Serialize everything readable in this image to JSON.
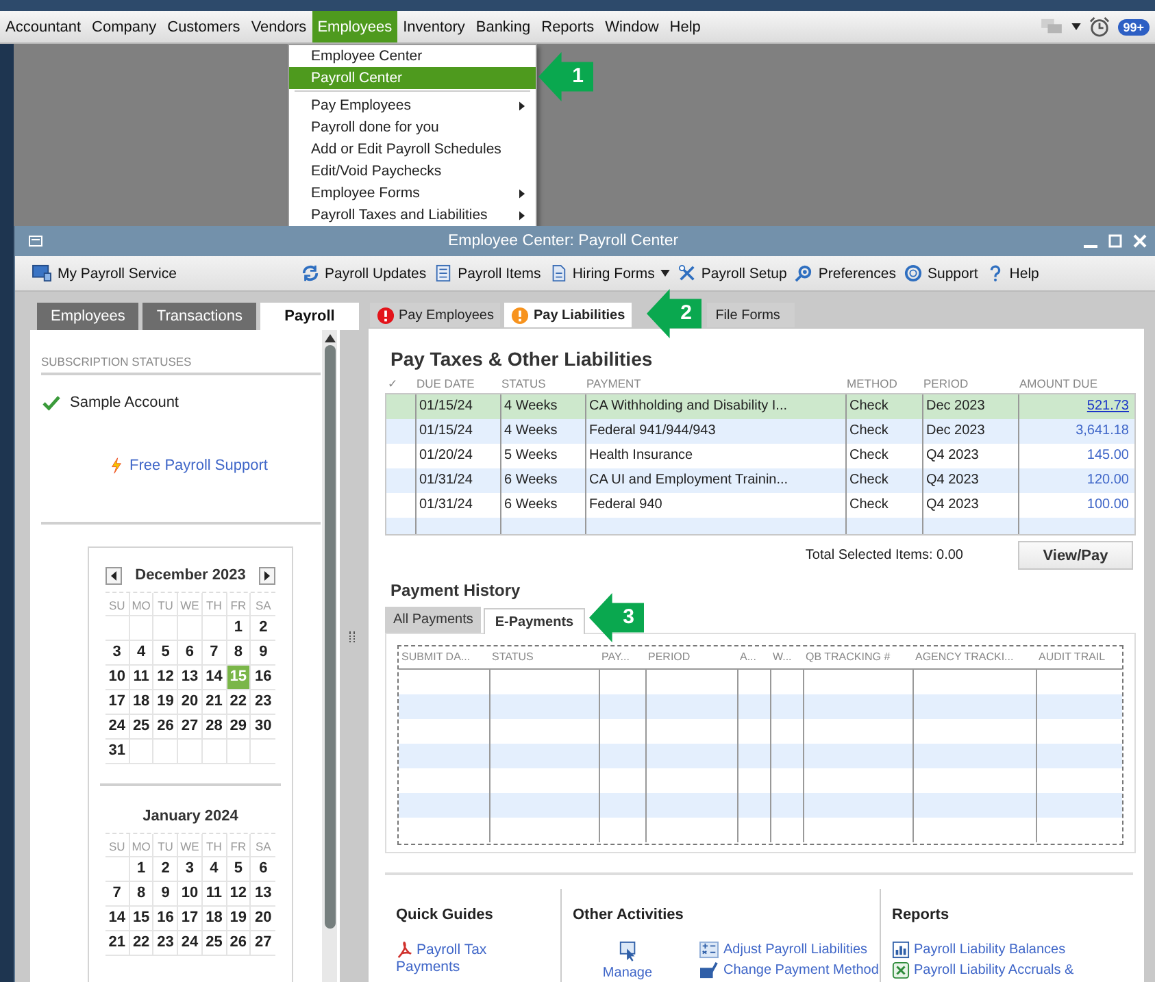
{
  "menubar": {
    "items": [
      {
        "label": "Accountant",
        "selected": false
      },
      {
        "label": "Company",
        "selected": false
      },
      {
        "label": "Customers",
        "selected": false
      },
      {
        "label": "Vendors",
        "selected": false
      },
      {
        "label": "Employees",
        "selected": true
      },
      {
        "label": "Inventory",
        "selected": false
      },
      {
        "label": "Banking",
        "selected": false
      },
      {
        "label": "Reports",
        "selected": false
      },
      {
        "label": "Window",
        "selected": false
      },
      {
        "label": "Help",
        "selected": false
      }
    ],
    "badge": "99+"
  },
  "employees_menu": {
    "items": [
      {
        "kind": "item",
        "label": "Employee Center",
        "selected": false,
        "submenu": false
      },
      {
        "kind": "item",
        "label": "Payroll Center",
        "selected": true,
        "submenu": false
      },
      {
        "kind": "separator"
      },
      {
        "kind": "item",
        "label": "Pay Employees",
        "selected": false,
        "submenu": true
      },
      {
        "kind": "item",
        "label": "Payroll done for you",
        "selected": false,
        "submenu": false
      },
      {
        "kind": "item",
        "label": "Add or Edit Payroll Schedules",
        "selected": false,
        "submenu": false
      },
      {
        "kind": "item",
        "label": "Edit/Void Paychecks",
        "selected": false,
        "submenu": false
      },
      {
        "kind": "item",
        "label": "Employee Forms",
        "selected": false,
        "submenu": true
      },
      {
        "kind": "item",
        "label": "Payroll Taxes and Liabilities",
        "selected": false,
        "submenu": true
      }
    ]
  },
  "callouts": [
    {
      "number": "1"
    },
    {
      "number": "2"
    },
    {
      "number": "3"
    }
  ],
  "window": {
    "title": "Employee Center: Payroll Center",
    "toolbar": {
      "service": "My Payroll Service",
      "items": [
        {
          "label": "Payroll Updates",
          "dropdown": false
        },
        {
          "label": "Payroll Items",
          "dropdown": false
        },
        {
          "label": "Hiring Forms",
          "dropdown": true
        },
        {
          "label": "Payroll Setup",
          "dropdown": false
        },
        {
          "label": "Preferences",
          "dropdown": false
        },
        {
          "label": "Support",
          "dropdown": false
        },
        {
          "label": "Help",
          "dropdown": false
        }
      ]
    }
  },
  "sidebar": {
    "tabs": [
      {
        "label": "Employees",
        "selected": false
      },
      {
        "label": "Transactions",
        "selected": false
      },
      {
        "label": "Payroll",
        "selected": true
      }
    ],
    "subscription_heading": "SUBSCRIPTION STATUSES",
    "subscriptions": [
      "Sample Account"
    ],
    "support_link": "Free Payroll Support",
    "calendars": [
      {
        "month": "December 2023",
        "nav_arrows": true,
        "weekdays": [
          "SU",
          "MO",
          "TU",
          "WE",
          "TH",
          "FR",
          "SA"
        ],
        "weeks": [
          {
            "kind": "first",
            "days": [
              {
                "day": "1",
                "selected": false
              },
              {
                "day": "2",
                "selected": false
              }
            ]
          },
          {
            "days": [
              {
                "day": "3",
                "selected": false
              },
              {
                "day": "4",
                "selected": false
              },
              {
                "day": "5",
                "selected": false
              },
              {
                "day": "6",
                "selected": false
              },
              {
                "day": "7",
                "selected": false
              },
              {
                "day": "8",
                "selected": false
              },
              {
                "day": "9",
                "selected": false
              }
            ]
          },
          {
            "days": [
              {
                "day": "10",
                "selected": false
              },
              {
                "day": "11",
                "selected": false
              },
              {
                "day": "12",
                "selected": false
              },
              {
                "day": "13",
                "selected": false
              },
              {
                "day": "14",
                "selected": false
              },
              {
                "day": "15",
                "selected": true
              },
              {
                "day": "16",
                "selected": false
              }
            ]
          },
          {
            "days": [
              {
                "day": "17",
                "selected": false
              },
              {
                "day": "18",
                "selected": false
              },
              {
                "day": "19",
                "selected": false
              },
              {
                "day": "20",
                "selected": false
              },
              {
                "day": "21",
                "selected": false
              },
              {
                "day": "22",
                "selected": false
              },
              {
                "day": "23",
                "selected": false
              }
            ]
          },
          {
            "days": [
              {
                "day": "24",
                "selected": false
              },
              {
                "day": "25",
                "selected": false
              },
              {
                "day": "26",
                "selected": false
              },
              {
                "day": "27",
                "selected": false
              },
              {
                "day": "28",
                "selected": false
              },
              {
                "day": "29",
                "selected": false
              },
              {
                "day": "30",
                "selected": false
              }
            ]
          },
          {
            "kind": "last",
            "days": [
              {
                "day": "31",
                "selected": false
              }
            ]
          }
        ]
      },
      {
        "month": "January 2024",
        "nav_arrows": false,
        "weekdays": [
          "SU",
          "MO",
          "TU",
          "WE",
          "TH",
          "FR",
          "SA"
        ],
        "weeks": [
          {
            "kind": "first",
            "days": [
              {
                "day": "1",
                "selected": false
              },
              {
                "day": "2",
                "selected": false
              },
              {
                "day": "3",
                "selected": false
              },
              {
                "day": "4",
                "selected": false
              },
              {
                "day": "5",
                "selected": false
              },
              {
                "day": "6",
                "selected": false
              }
            ]
          },
          {
            "days": [
              {
                "day": "7",
                "selected": false
              },
              {
                "day": "8",
                "selected": false
              },
              {
                "day": "9",
                "selected": false
              },
              {
                "day": "10",
                "selected": false
              },
              {
                "day": "11",
                "selected": false
              },
              {
                "day": "12",
                "selected": false
              },
              {
                "day": "13",
                "selected": false
              }
            ]
          },
          {
            "days": [
              {
                "day": "14",
                "selected": false
              },
              {
                "day": "15",
                "selected": false
              },
              {
                "day": "16",
                "selected": false
              },
              {
                "day": "17",
                "selected": false
              },
              {
                "day": "18",
                "selected": false
              },
              {
                "day": "19",
                "selected": false
              },
              {
                "day": "20",
                "selected": false
              }
            ]
          },
          {
            "days": [
              {
                "day": "21",
                "selected": false
              },
              {
                "day": "22",
                "selected": false
              },
              {
                "day": "23",
                "selected": false
              },
              {
                "day": "24",
                "selected": false
              },
              {
                "day": "25",
                "selected": false
              },
              {
                "day": "26",
                "selected": false
              },
              {
                "day": "27",
                "selected": false
              }
            ]
          }
        ]
      }
    ]
  },
  "payroll": {
    "tabs": [
      {
        "label": "Pay Employees",
        "selected": false,
        "color": "#e3141b"
      },
      {
        "label": "Pay Liabilities",
        "selected": true,
        "color": "#f7931e"
      },
      {
        "label": "File Forms",
        "selected": false
      }
    ],
    "liabilities": {
      "title": "Pay Taxes & Other Liabilities",
      "columns": [
        "✓",
        "DUE DATE",
        "STATUS",
        "PAYMENT",
        "METHOD",
        "PERIOD",
        "AMOUNT DUE"
      ],
      "rows": [
        {
          "due_date": "01/15/24",
          "status": "4 Weeks",
          "payment": "CA Withholding and Disability I...",
          "method": "Check",
          "period": "Dec 2023",
          "amount_due": "521.73",
          "selected": true
        },
        {
          "due_date": "01/15/24",
          "status": "4 Weeks",
          "payment": "Federal 941/944/943",
          "method": "Check",
          "period": "Dec 2023",
          "amount_due": "3,641.18",
          "selected": false
        },
        {
          "due_date": "01/20/24",
          "status": "5 Weeks",
          "payment": "Health Insurance",
          "method": "Check",
          "period": "Q4 2023",
          "amount_due": "145.00",
          "selected": false
        },
        {
          "due_date": "01/31/24",
          "status": "6 Weeks",
          "payment": "CA UI and Employment Trainin...",
          "method": "Check",
          "period": "Q4 2023",
          "amount_due": "120.00",
          "selected": false
        },
        {
          "due_date": "01/31/24",
          "status": "6 Weeks",
          "payment": "Federal 940",
          "method": "Check",
          "period": "Q4 2023",
          "amount_due": "100.00",
          "selected": false
        }
      ],
      "total": "Total Selected Items: 0.00",
      "button": "View/Pay"
    },
    "history": {
      "title": "Payment History",
      "tabs": [
        {
          "label": "All Payments",
          "selected": false
        },
        {
          "label": "E-Payments",
          "selected": true
        }
      ],
      "columns": [
        "SUBMIT DA...",
        "STATUS",
        "PAY...",
        "PERIOD",
        "A...",
        "W...",
        "QB TRACKING #",
        "AGENCY TRACKI...",
        "AUDIT TRAIL"
      ]
    },
    "quick_guides": {
      "title": "Quick Guides",
      "links": [
        "Payroll Tax Payments"
      ]
    },
    "other_activities": {
      "title": "Other Activities",
      "manage": "Manage",
      "links": [
        "Adjust Payroll Liabilities",
        "Change Payment Method"
      ]
    },
    "reports": {
      "title": "Reports",
      "links": [
        "Payroll Liability Balances",
        "Payroll Liability Accruals &"
      ]
    }
  }
}
